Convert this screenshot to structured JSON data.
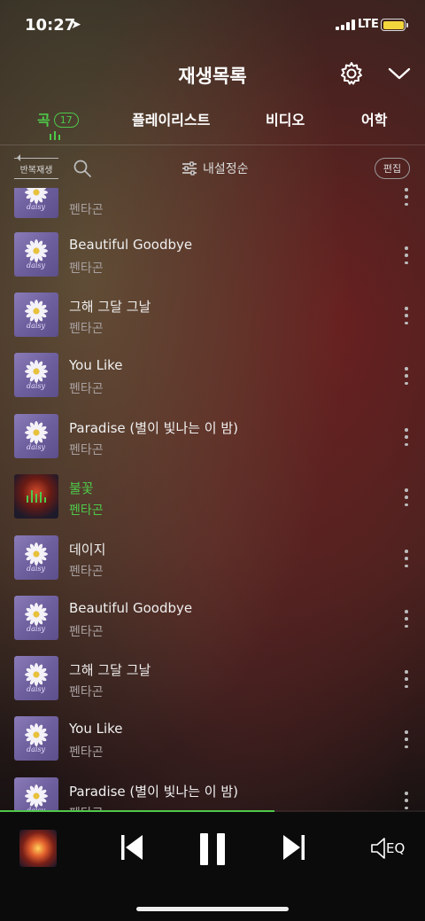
{
  "status_bar": {
    "time": "10:27",
    "network": "LTE"
  },
  "header": {
    "title": "재생목록"
  },
  "tabs": [
    {
      "label": "곡",
      "count": "17",
      "active": true
    },
    {
      "label": "플레이리스트"
    },
    {
      "label": "비디오"
    },
    {
      "label": "어학"
    }
  ],
  "toolbar": {
    "repeat_label": "반복재생",
    "sort_label": "내설정순",
    "edit_label": "편집"
  },
  "songs": [
    {
      "title": "",
      "artist": "펜타곤"
    },
    {
      "title": "Beautiful Goodbye",
      "artist": "펜타곤"
    },
    {
      "title": "그해 그달 그날",
      "artist": "펜타곤"
    },
    {
      "title": "You Like",
      "artist": "펜타곤"
    },
    {
      "title": "Paradise (별이 빛나는 이 밤)",
      "artist": "펜타곤"
    },
    {
      "title": "불꽃",
      "artist": "펜타곤",
      "playing": true
    },
    {
      "title": "데이지",
      "artist": "펜타곤"
    },
    {
      "title": "Beautiful Goodbye",
      "artist": "펜타곤"
    },
    {
      "title": "그해 그달 그날",
      "artist": "펜타곤"
    },
    {
      "title": "You Like",
      "artist": "펜타곤"
    },
    {
      "title": "Paradise (별이 빛나는 이 밤)",
      "artist": "펜타곤"
    }
  ],
  "album_art_script": "daisy",
  "player": {
    "progress": 0.645,
    "eq_label": "EQ"
  },
  "colors": {
    "accent": "#4fc84a",
    "player_bg": "#0b0b0b"
  }
}
